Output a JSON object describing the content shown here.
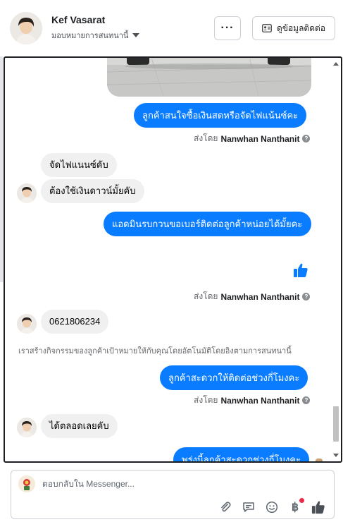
{
  "header": {
    "name": "Kef Vasarat",
    "assign_label": "มอบหมายการสนทนานี้",
    "more_label": "···",
    "contact_label": "ดูข้อมูลติดต่อ"
  },
  "messages": {
    "m1_out": "ลูกค้าสนใจซื้อเงินสดหรือจัดไฟแน้นซ์คะ",
    "sent_prefix": "ส่งโดย",
    "sender_name": "Nanwhan Nanthanit",
    "m2_in": "จัดไฟแนนซ์คับ",
    "m3_in": "ต้องใช้เงินดาวน์มั้ยคับ",
    "m4_out": "แอดมินรบกวนขอเบอร์ติดต่อลูกค้าหน่อยได้มั้ยคะ",
    "m5_in": "0621806234",
    "system_note": "เราสร้างกิจกรรมของลูกค้าเป้าหมายให้กับคุณโดยอัตโนมัติโดยอิงตามการสนทนานี้",
    "m6_out": "ลูกค้าสะดวกให้ติดต่อช่วงกี่โมงคะ",
    "m7_in": "ได้ตลอดเลยคับ",
    "m8_out": "พรุ่งนี้ลูกค้าสะดวกช่วงกี่โมงคะ"
  },
  "composer": {
    "placeholder": "ตอบกลับใน Messenger...",
    "currency_symbol": "฿"
  },
  "colors": {
    "accent": "#0a7cff",
    "incoming_bubble": "#f0f0f0",
    "notification_badge": "#f02849"
  }
}
